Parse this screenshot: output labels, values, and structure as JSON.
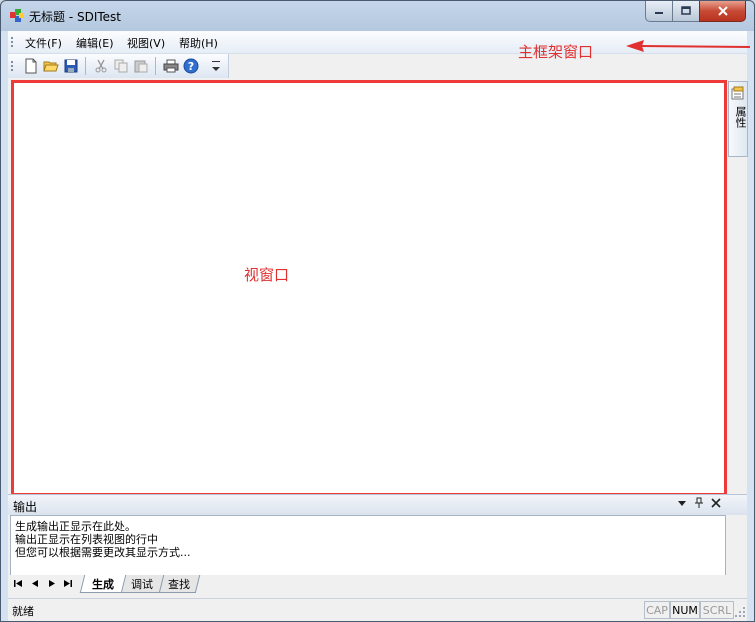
{
  "window": {
    "title": "无标题 - SDITest"
  },
  "menu": [
    "文件(F)",
    "编辑(E)",
    "视图(V)",
    "帮助(H)"
  ],
  "toolbar": [
    "new-file-icon",
    "open-folder-icon",
    "save-icon",
    "cut-icon",
    "copy-icon",
    "paste-icon",
    "print-icon",
    "help-icon"
  ],
  "annotations": {
    "main_frame": "主框架窗口",
    "view": "视窗口"
  },
  "side_tab": {
    "label": "属性"
  },
  "output": {
    "title": "输出",
    "lines": [
      "生成输出正显示在此处。",
      "输出正显示在列表视图的行中",
      "但您可以根据需要更改其显示方式..."
    ],
    "tabs": [
      "生成",
      "调试",
      "查找"
    ]
  },
  "status": {
    "text": "就绪",
    "indicators": [
      "CAP",
      "NUM",
      "SCRL"
    ]
  },
  "colors": {
    "annotation": "#e03030",
    "frame_border": "#ef3a3a"
  }
}
